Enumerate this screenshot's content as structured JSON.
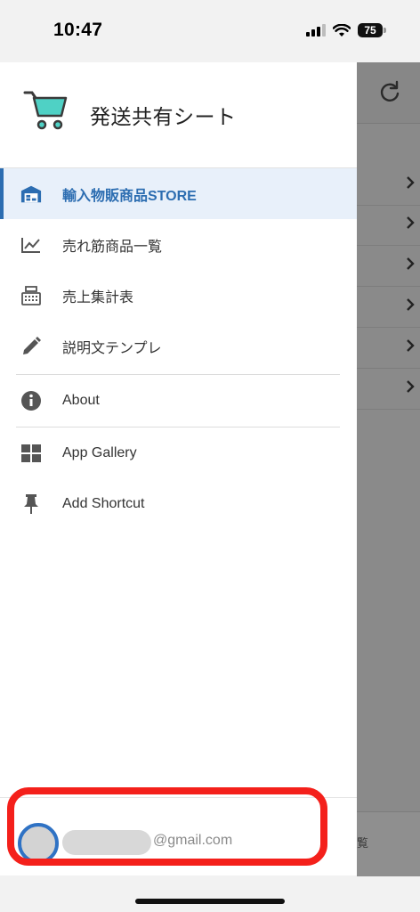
{
  "status_bar": {
    "time": "10:47",
    "battery": "75",
    "icons": [
      "signal-icon",
      "wifi-icon",
      "battery-icon"
    ]
  },
  "drawer": {
    "title": "発送共有シート",
    "logo_icon": "cart-icon",
    "items": [
      {
        "label": "輸入物販商品STORE",
        "icon": "warehouse-icon",
        "active": true
      },
      {
        "label": "売れ筋商品一覧",
        "icon": "trending-chart-icon",
        "active": false
      },
      {
        "label": "売上集計表",
        "icon": "cash-register-icon",
        "active": false
      },
      {
        "label": "説明文テンプレ",
        "icon": "pencil-icon",
        "active": false
      },
      {
        "label": "About",
        "icon": "info-icon",
        "active": false
      },
      {
        "label": "App Gallery",
        "icon": "grid-icon",
        "active": false
      },
      {
        "label": "Add Shortcut",
        "icon": "pin-icon",
        "active": false
      }
    ],
    "account": {
      "email_domain": "@gmail.com"
    }
  },
  "background": {
    "footer_text": "覧",
    "icons": [
      "refresh-icon",
      "chevron-right-icon"
    ]
  },
  "colors": {
    "accent": "#2c6db1",
    "active_bg": "#e8f0fa",
    "highlight": "#f4201b",
    "logo_cart": "#4fd1c5",
    "overlay": "#8a8a8a"
  }
}
